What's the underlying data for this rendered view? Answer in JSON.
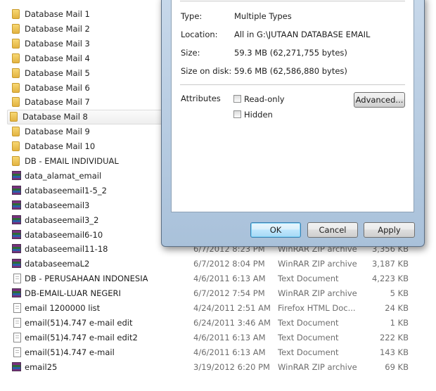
{
  "files": [
    {
      "name": "Database Mail 1",
      "icon": "folder-icon",
      "date": "",
      "type": "",
      "size": ""
    },
    {
      "name": "Database Mail 2",
      "icon": "folder-icon",
      "date": "",
      "type": "",
      "size": ""
    },
    {
      "name": "Database Mail 3",
      "icon": "folder-icon",
      "date": "",
      "type": "",
      "size": ""
    },
    {
      "name": "Database Mail 4",
      "icon": "folder-icon",
      "date": "",
      "type": "",
      "size": ""
    },
    {
      "name": "Database Mail 5",
      "icon": "folder-icon",
      "date": "",
      "type": "",
      "size": ""
    },
    {
      "name": "Database Mail 6",
      "icon": "folder-icon",
      "date": "",
      "type": "",
      "size": ""
    },
    {
      "name": "Database Mail 7",
      "icon": "folder-icon",
      "date": "",
      "type": "",
      "size": ""
    },
    {
      "name": "Database Mail 8",
      "icon": "folder-icon",
      "date": "",
      "type": "",
      "size": "",
      "selected": true
    },
    {
      "name": "Database Mail 9",
      "icon": "folder-icon",
      "date": "",
      "type": "",
      "size": ""
    },
    {
      "name": "Database Mail 10",
      "icon": "folder-icon",
      "date": "",
      "type": "",
      "size": ""
    },
    {
      "name": "DB - EMAIL INDIVIDUAL",
      "icon": "folder-icon",
      "date": "",
      "type": "",
      "size": ""
    },
    {
      "name": "data_alamat_email",
      "icon": "winrar-icon",
      "date": "",
      "type": "",
      "size": ""
    },
    {
      "name": "databaseemail1-5_2",
      "icon": "winrar-icon",
      "date": "",
      "type": "",
      "size": ""
    },
    {
      "name": "databaseemail3",
      "icon": "winrar-icon",
      "date": "",
      "type": "",
      "size": ""
    },
    {
      "name": "databaseemail3_2",
      "icon": "winrar-icon",
      "date": "",
      "type": "",
      "size": ""
    },
    {
      "name": "databaseemail6-10",
      "icon": "winrar-icon",
      "date": "",
      "type": "",
      "size": ""
    },
    {
      "name": "databaseemail11-18",
      "icon": "winrar-icon",
      "date": "6/7/2012 8:23 PM",
      "type": "WinRAR ZIP archive",
      "size": "3,356 KB"
    },
    {
      "name": "databaseemaL2",
      "icon": "winrar-icon",
      "date": "6/7/2012 8:04 PM",
      "type": "WinRAR ZIP archive",
      "size": "3,187 KB"
    },
    {
      "name": "DB - PERUSAHAAN INDONESIA",
      "icon": "text-document-icon",
      "date": "4/6/2011 6:13 AM",
      "type": "Text Document",
      "size": "4,223 KB"
    },
    {
      "name": "DB-EMAIL-LUAR NEGERI",
      "icon": "winrar-icon",
      "date": "6/7/2012 7:54 PM",
      "type": "WinRAR ZIP archive",
      "size": "5 KB"
    },
    {
      "name": "email 1200000 list",
      "icon": "text-document-icon",
      "date": "4/24/2011 2:51 AM",
      "type": "Firefox HTML Doc...",
      "size": "24 KB"
    },
    {
      "name": "email(51)4.747 e-mail edit",
      "icon": "text-document-icon",
      "date": "6/24/2011 3:46 AM",
      "type": "Text Document",
      "size": "1 KB"
    },
    {
      "name": "email(51)4.747 e-mail edit2",
      "icon": "text-document-icon",
      "date": "4/6/2011 6:13 AM",
      "type": "Text Document",
      "size": "222 KB"
    },
    {
      "name": "email(51)4.747 e-mail",
      "icon": "text-document-icon",
      "date": "4/6/2011 6:13 AM",
      "type": "Text Document",
      "size": "143 KB"
    },
    {
      "name": "email25",
      "icon": "winrar-icon",
      "date": "3/19/2012 6:20 PM",
      "type": "WinRAR ZIP archive",
      "size": "69 KB"
    }
  ],
  "dialog": {
    "type_label": "Type:",
    "type_value": "Multiple Types",
    "location_label": "Location:",
    "location_value": "All in G:\\JUTAAN DATABASE EMAIL",
    "size_label": "Size:",
    "size_value": "59.3 MB (62,271,755 bytes)",
    "size_on_disk_label": "Size on disk:",
    "size_on_disk_value": "59.6 MB (62,586,880 bytes)",
    "attributes_label": "Attributes",
    "readonly_label": "Read-only",
    "hidden_label": "Hidden",
    "advanced_button": "Advanced...",
    "ok_button": "OK",
    "cancel_button": "Cancel",
    "apply_button": "Apply"
  }
}
